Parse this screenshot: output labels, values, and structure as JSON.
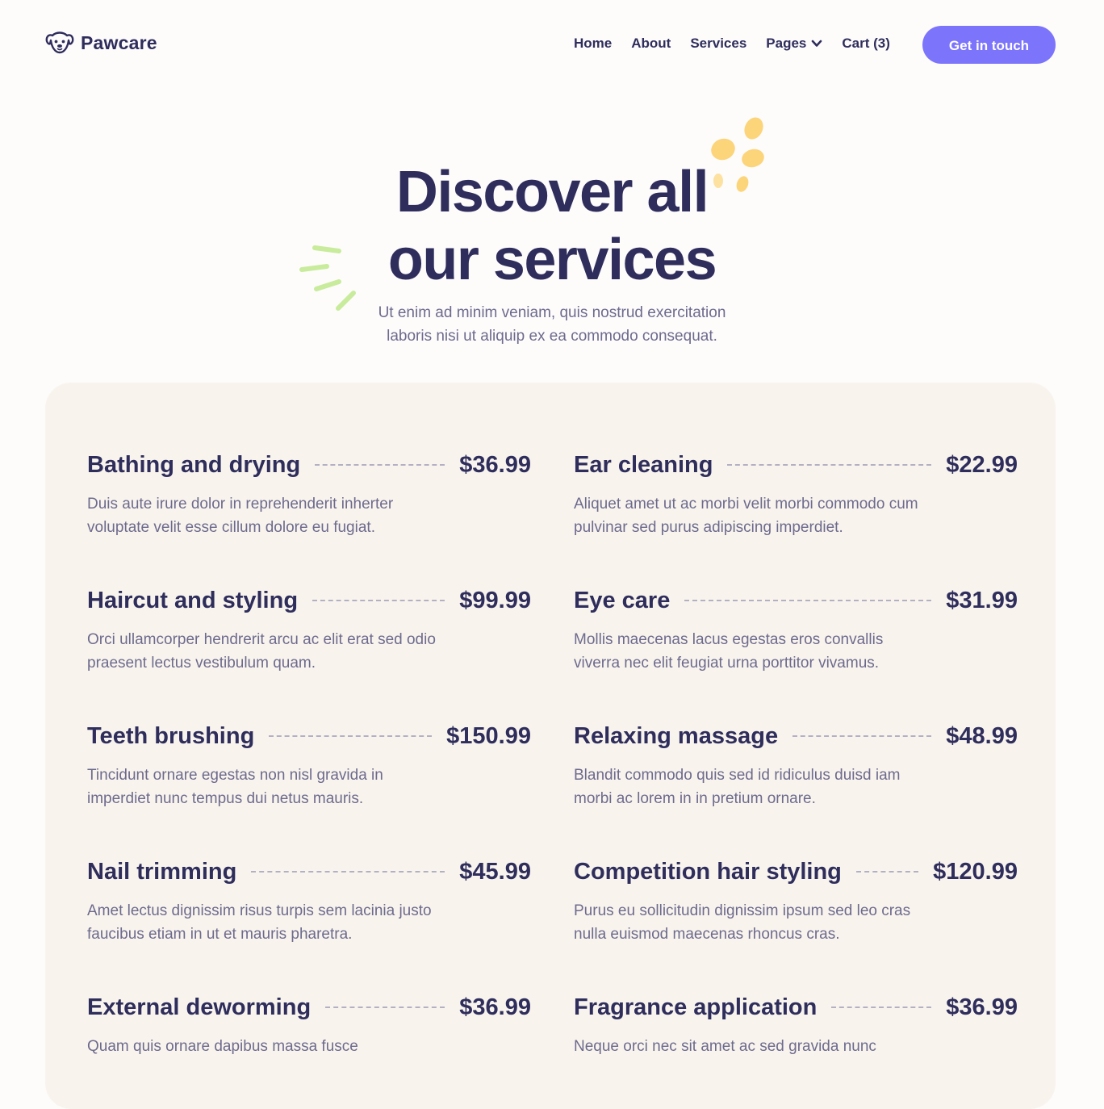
{
  "brand": {
    "name": "Pawcare"
  },
  "nav": {
    "items": [
      {
        "label": "Home"
      },
      {
        "label": "About"
      },
      {
        "label": "Services"
      },
      {
        "label": "Pages"
      },
      {
        "label": "Cart (3)"
      }
    ],
    "cta_label": "Get in touch"
  },
  "hero": {
    "title_line1": "Discover all",
    "title_line2": "our services",
    "subtitle_line1": "Ut enim ad minim veniam, quis nostrud exercitation",
    "subtitle_line2": "laboris nisi ut aliquip ex ea commodo consequat."
  },
  "services": [
    {
      "name": "Bathing and drying",
      "price": "$36.99",
      "desc": "Duis aute irure dolor in reprehenderit inherter voluptate velit esse cillum dolore eu fugiat."
    },
    {
      "name": "Ear cleaning",
      "price": "$22.99",
      "desc": "Aliquet amet ut ac morbi velit morbi commodo cum pulvinar sed purus adipiscing imperdiet."
    },
    {
      "name": "Haircut and styling",
      "price": "$99.99",
      "desc": "Orci ullamcorper hendrerit arcu ac elit erat sed odio praesent lectus vestibulum quam."
    },
    {
      "name": "Eye care",
      "price": "$31.99",
      "desc": "Mollis maecenas lacus egestas eros convallis viverra nec elit feugiat urna porttitor vivamus."
    },
    {
      "name": "Teeth brushing",
      "price": "$150.99",
      "desc": "Tincidunt ornare egestas non nisl gravida in imperdiet nunc tempus dui netus mauris."
    },
    {
      "name": "Relaxing massage",
      "price": "$48.99",
      "desc": "Blandit commodo quis sed id ridiculus duisd iam morbi ac lorem in in pretium ornare."
    },
    {
      "name": "Nail trimming",
      "price": "$45.99",
      "desc": "Amet lectus dignissim risus turpis sem lacinia justo faucibus etiam in ut et mauris pharetra."
    },
    {
      "name": "Competition hair styling",
      "price": "$120.99",
      "desc": "Purus eu sollicitudin dignissim ipsum sed leo cras nulla euismod maecenas rhoncus cras."
    },
    {
      "name": "External deworming",
      "price": "$36.99",
      "desc": "Quam quis ornare dapibus massa fusce"
    },
    {
      "name": "Fragrance application",
      "price": "$36.99",
      "desc": "Neque orci nec sit amet ac sed gravida nunc"
    }
  ],
  "colors": {
    "accent": "#7c74fb",
    "heading": "#2f2d5c",
    "body_text": "#6e6a8e",
    "panel_bg": "#f8f4ed",
    "deco_yellow": "#fcd57a",
    "deco_green": "#c8ec9c"
  },
  "icons": {
    "logo": "dog-face-icon",
    "pages_dropdown": "chevron-down-icon"
  }
}
